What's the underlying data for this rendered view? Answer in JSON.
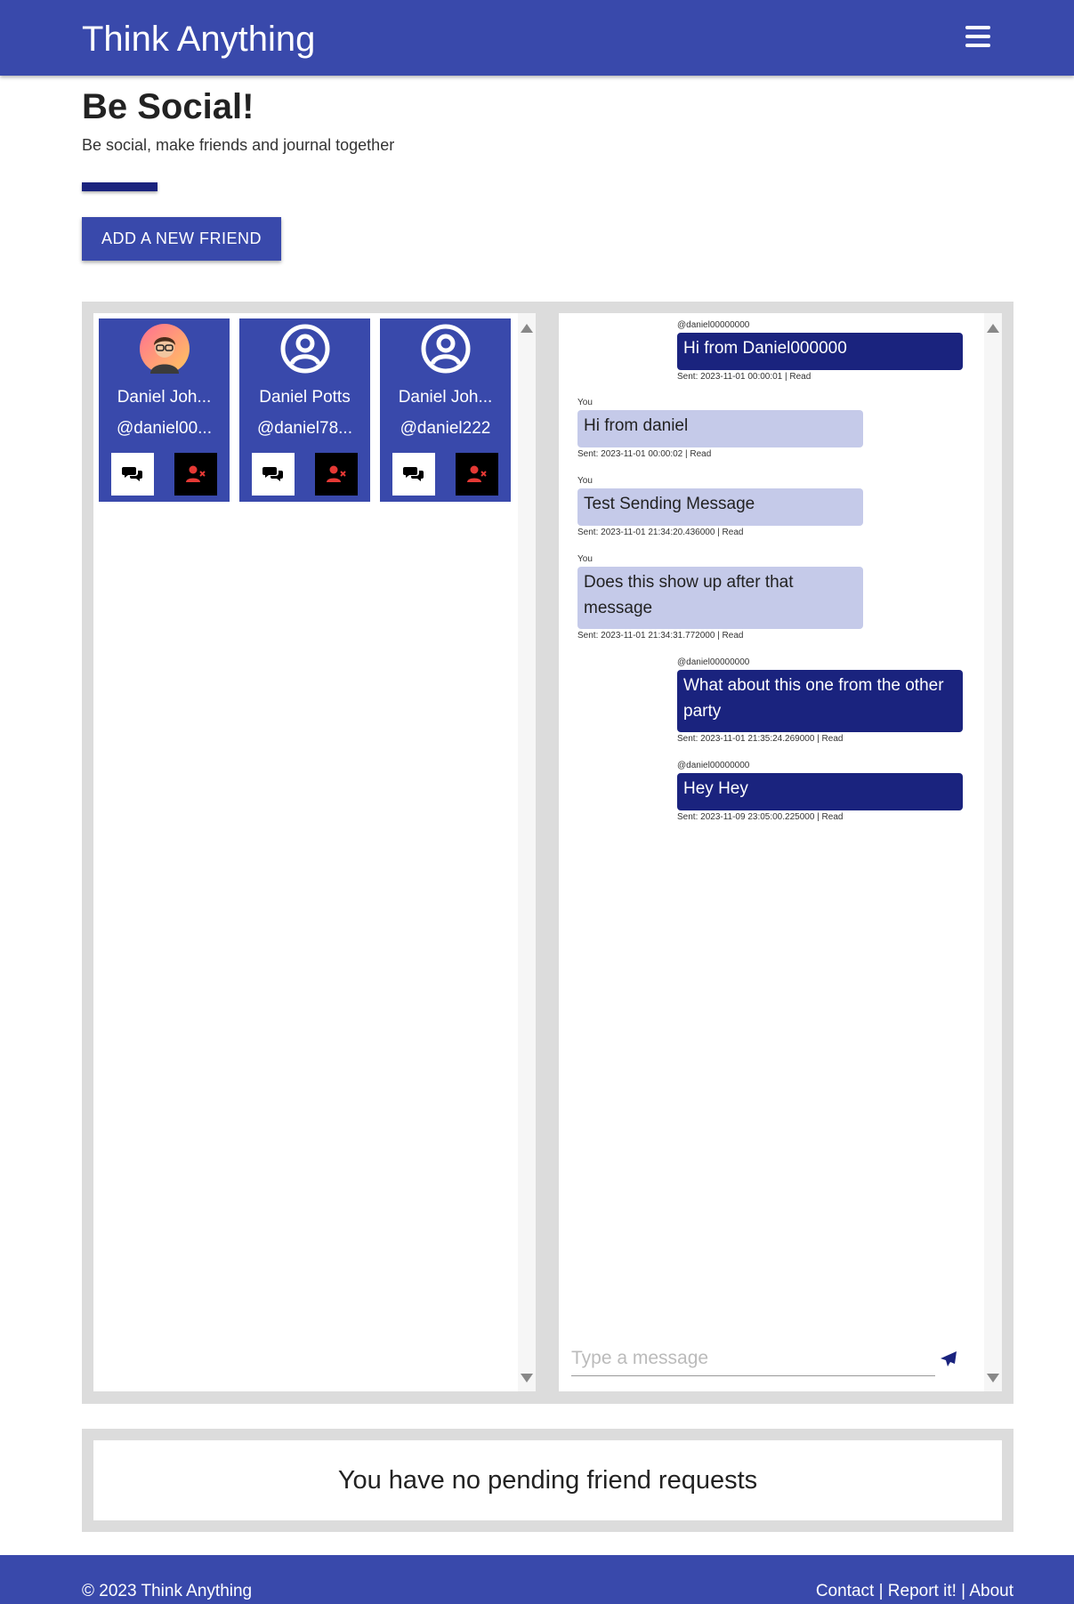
{
  "header": {
    "brand": "Think Anything",
    "menu_icon": "hamburger-menu-icon"
  },
  "intro": {
    "title_prefix": "Be ",
    "title_bold": "Social",
    "title_suffix": "!",
    "subtitle": "Be social, make friends and journal together",
    "add_friend_label": "ADD A NEW FRIEND"
  },
  "friends": [
    {
      "name": "Daniel Joh...",
      "handle": "@daniel00...",
      "avatar": "profile-photo"
    },
    {
      "name": "Daniel Potts",
      "handle": "@daniel78...",
      "avatar": "default-user-icon"
    },
    {
      "name": "Daniel Joh...",
      "handle": "@daniel222",
      "avatar": "default-user-icon"
    }
  ],
  "chat": {
    "messages": [
      {
        "from": "@daniel00000000",
        "text": "Hi from Daniel000000",
        "meta": "Sent: 2023-11-01 00:00:01 | Read",
        "mine": false
      },
      {
        "from": "You",
        "text": "Hi from daniel",
        "meta": "Sent: 2023-11-01 00:00:02 | Read",
        "mine": true
      },
      {
        "from": "You",
        "text": "Test Sending Message",
        "meta": "Sent: 2023-11-01 21:34:20.436000 | Read",
        "mine": true
      },
      {
        "from": "You",
        "text": "Does this show up after that message",
        "meta": "Sent: 2023-11-01 21:34:31.772000 | Read",
        "mine": true
      },
      {
        "from": "@daniel00000000",
        "text": "What about this one from the other party",
        "meta": "Sent: 2023-11-01 21:35:24.269000 | Read",
        "mine": false
      },
      {
        "from": "@daniel00000000",
        "text": "Hey Hey",
        "meta": "Sent: 2023-11-09 23:05:00.225000 | Read",
        "mine": false
      }
    ],
    "input_placeholder": "Type a message",
    "input_value": ""
  },
  "pending": {
    "text": "You have no pending friend requests"
  },
  "footer": {
    "copyright": "© 2023 Think Anything",
    "links": [
      "Contact",
      "Report it!",
      "About"
    ],
    "separator": " | "
  },
  "colors": {
    "primary": "#3949ab",
    "dark": "#1a237e",
    "light_bubble": "#c5cae9",
    "remove_icon": "#e53935"
  }
}
